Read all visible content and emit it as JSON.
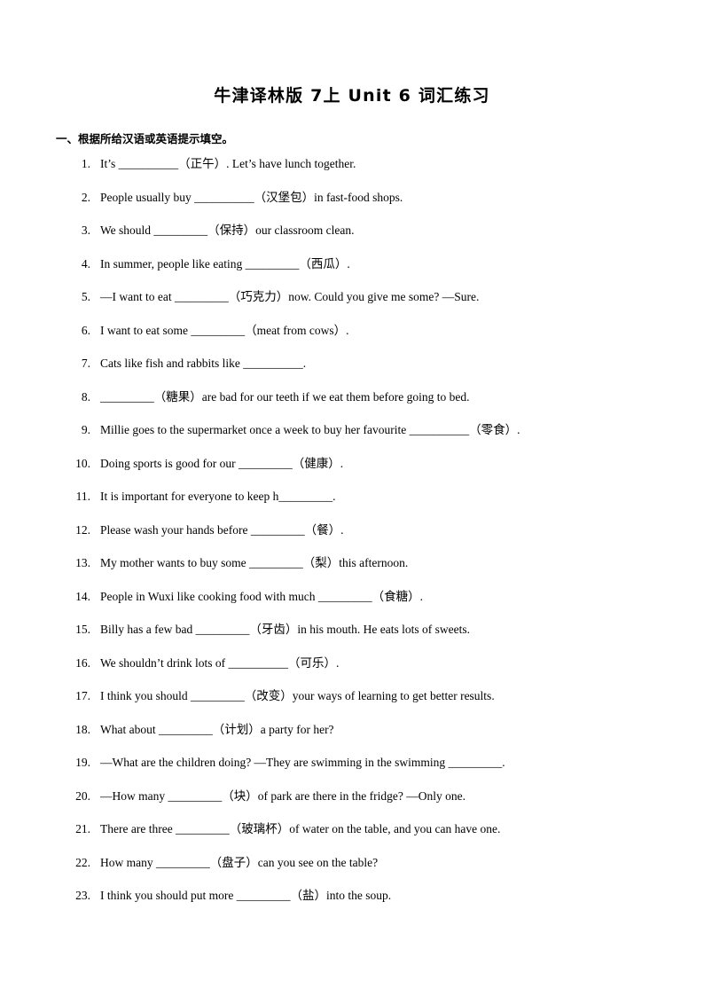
{
  "document": {
    "title": "牛津译林版 7上 Unit 6 词汇练习",
    "section_header": "一、根据所给汉语或英语提示填空。"
  },
  "questions": [
    {
      "number": "1.",
      "text": "It’s __________（正午）. Let’s have lunch together."
    },
    {
      "number": "2.",
      "text": "People usually buy __________（汉堡包）in fast-food shops."
    },
    {
      "number": "3.",
      "text": "We should _________（保持）our classroom clean."
    },
    {
      "number": "4.",
      "text": "In summer, people like eating _________（西瓜）."
    },
    {
      "number": "5.",
      "text": "—I want to eat _________（巧克力）now. Could you give me some?   —Sure."
    },
    {
      "number": "6.",
      "text": "I want to eat some _________（meat from cows）."
    },
    {
      "number": "7.",
      "text": "Cats like fish and rabbits like __________."
    },
    {
      "number": "8.",
      "text": "_________（糖果）are bad for our teeth if we eat them before going to bed."
    },
    {
      "number": "9.",
      "text": "Millie goes to the supermarket once a week to buy her favourite __________（零食）."
    },
    {
      "number": "10.",
      "text": "Doing sports is good for our _________（健康）."
    },
    {
      "number": "11.",
      "text": "It is important for everyone to keep h_________."
    },
    {
      "number": "12.",
      "text": "Please wash your hands before _________（餐）."
    },
    {
      "number": "13.",
      "text": "My mother wants to buy some _________（梨）this afternoon."
    },
    {
      "number": "14.",
      "text": "People in Wuxi like cooking food with much _________（食糖）."
    },
    {
      "number": "15.",
      "text": "Billy has a few bad _________（牙齿）in his mouth. He eats lots of sweets."
    },
    {
      "number": "16.",
      "text": "We shouldn’t drink lots of __________（可乐）."
    },
    {
      "number": "17.",
      "text": "I think you should _________（改变）your ways of learning to get better results."
    },
    {
      "number": "18.",
      "text": "What about _________（计划）a party for her?"
    },
    {
      "number": "19.",
      "text": "—What are the children doing?   —They are swimming in the swimming _________."
    },
    {
      "number": "20.",
      "text": "—How many _________（块）of park are there in the fridge?    —Only one."
    },
    {
      "number": "21.",
      "text": "There are three _________（玻璃杯）of water on the table, and you can have one."
    },
    {
      "number": "22.",
      "text": "How many _________（盘子）can you see on the table?"
    },
    {
      "number": "23.",
      "text": "I think you should put more _________（盐）into the soup."
    }
  ]
}
